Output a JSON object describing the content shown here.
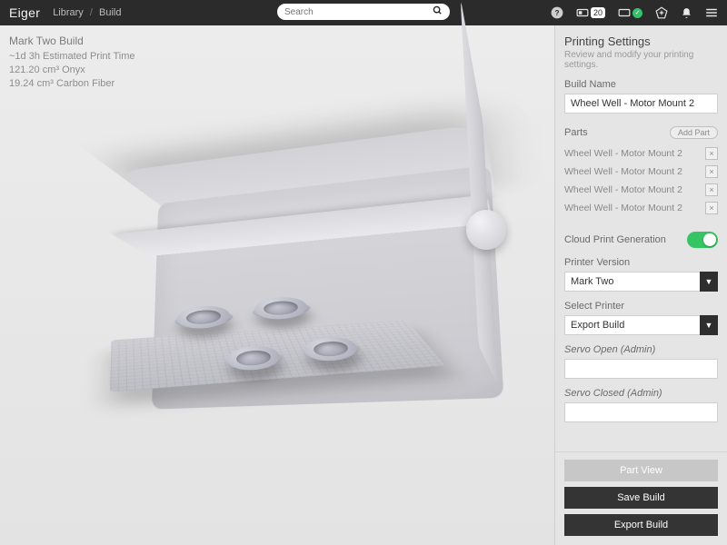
{
  "header": {
    "brand": "Eiger",
    "crumb1": "Library",
    "crumb2": "Build",
    "search_placeholder": "Search",
    "queue_count": "20"
  },
  "stage": {
    "title": "Mark Two Build",
    "line_time": "~1d 3h Estimated Print Time",
    "line_mat1": "121.20 cm³ Onyx",
    "line_mat2": "19.24 cm³ Carbon Fiber"
  },
  "panel": {
    "title": "Printing Settings",
    "subtitle": "Review and modify your printing settings.",
    "build_name_label": "Build Name",
    "build_name_value": "Wheel Well - Motor Mount 2",
    "parts_label": "Parts",
    "add_part_label": "Add Part",
    "parts": [
      "Wheel Well - Motor Mount 2",
      "Wheel Well - Motor Mount 2",
      "Wheel Well - Motor Mount 2",
      "Wheel Well - Motor Mount 2"
    ],
    "cloud_label": "Cloud Print Generation",
    "printer_version_label": "Printer Version",
    "printer_version_value": "Mark Two",
    "select_printer_label": "Select Printer",
    "select_printer_value": "Export Build",
    "servo_open_label": "Servo Open (Admin)",
    "servo_closed_label": "Servo Closed (Admin)"
  },
  "footer": {
    "part_view": "Part View",
    "save": "Save Build",
    "export": "Export Build"
  }
}
